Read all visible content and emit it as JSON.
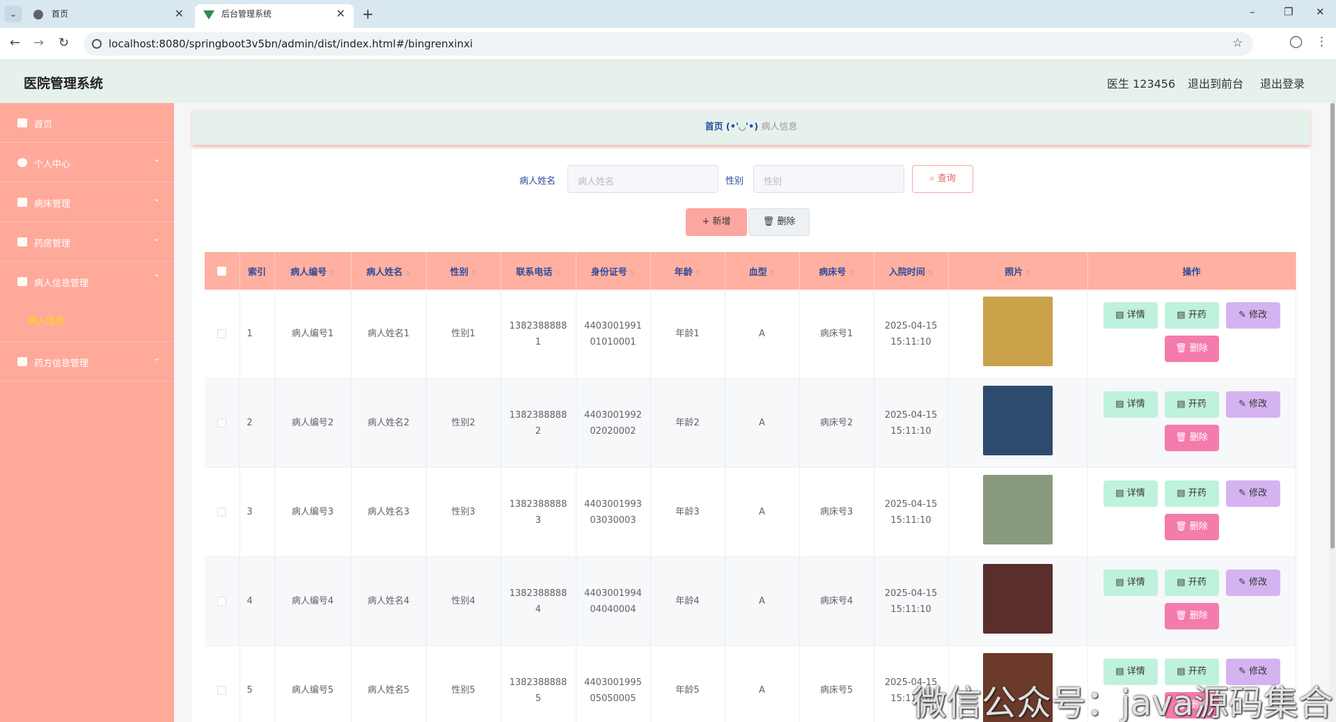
{
  "browser": {
    "tabs": [
      {
        "label": "首页",
        "active": false
      },
      {
        "label": "后台管理系统",
        "active": true
      }
    ],
    "new_tab": "+",
    "url": "localhost:8080/springboot3v5bn/admin/dist/index.html#/bingrenxinxi",
    "window_controls": [
      "–",
      "❐",
      "✕"
    ]
  },
  "header": {
    "title": "医院管理系统",
    "user": "医生 123456",
    "exit_front": "退出到前台",
    "logout": "退出登录"
  },
  "sidebar": {
    "items": [
      {
        "label": "首页",
        "icon": "home-icon",
        "arrow": ""
      },
      {
        "label": "个人中心",
        "icon": "user-icon",
        "arrow": "⌄"
      },
      {
        "label": "病床管理",
        "icon": "mail-icon",
        "arrow": "⌄"
      },
      {
        "label": "药房管理",
        "icon": "briefcase-icon",
        "arrow": "⌄"
      },
      {
        "label": "病人信息管理",
        "icon": "clipboard-icon",
        "arrow": "⌃"
      },
      {
        "label": "药方信息管理",
        "icon": "grid-icon",
        "arrow": "⌄"
      }
    ],
    "sub_item": "病人信息"
  },
  "breadcrumb": {
    "home": "首页",
    "separator": "(•'◡'•)",
    "current": "病人信息"
  },
  "search": {
    "name_label": "病人姓名",
    "name_placeholder": "病人姓名",
    "gender_label": "性别",
    "gender_placeholder": "性别",
    "query_button": "查询"
  },
  "actions": {
    "add": "新增",
    "delete": "删除"
  },
  "table": {
    "headers": [
      "索引",
      "病人编号",
      "病人姓名",
      "性别",
      "联系电话",
      "身份证号",
      "年龄",
      "血型",
      "病床号",
      "入院时间",
      "照片",
      "操作"
    ],
    "rows": [
      {
        "idx": "1",
        "no": "病人编号1",
        "name": "病人姓名1",
        "gender": "性别1",
        "phone": "13823888881",
        "id": "440300199101010001",
        "age": "年龄1",
        "blood": "A",
        "bed": "病床号1",
        "date": "2025-04-15 15:11:10",
        "photo_color": "#c9a24a"
      },
      {
        "idx": "2",
        "no": "病人编号2",
        "name": "病人姓名2",
        "gender": "性别2",
        "phone": "13823888882",
        "id": "440300199202020002",
        "age": "年龄2",
        "blood": "A",
        "bed": "病床号2",
        "date": "2025-04-15 15:11:10",
        "photo_color": "#2d4b6e"
      },
      {
        "idx": "3",
        "no": "病人编号3",
        "name": "病人姓名3",
        "gender": "性别3",
        "phone": "13823888883",
        "id": "440300199303030003",
        "age": "年龄3",
        "blood": "A",
        "bed": "病床号3",
        "date": "2025-04-15 15:11:10",
        "photo_color": "#8a9a7e"
      },
      {
        "idx": "4",
        "no": "病人编号4",
        "name": "病人姓名4",
        "gender": "性别4",
        "phone": "13823888884",
        "id": "440300199404040004",
        "age": "年龄4",
        "blood": "A",
        "bed": "病床号4",
        "date": "2025-04-15 15:11:10",
        "photo_color": "#5a2e2a"
      },
      {
        "idx": "5",
        "no": "病人编号5",
        "name": "病人姓名5",
        "gender": "性别5",
        "phone": "13823888885",
        "id": "440300199505050005",
        "age": "年龄5",
        "blood": "A",
        "bed": "病床号5",
        "date": "2025-04-15 15:11:10",
        "photo_color": "#6b3a2a"
      }
    ],
    "row_buttons": {
      "detail": "详情",
      "prescribe": "开药",
      "edit": "修改",
      "delete": "删除"
    }
  },
  "watermark": "微信公众号：java源码集合"
}
